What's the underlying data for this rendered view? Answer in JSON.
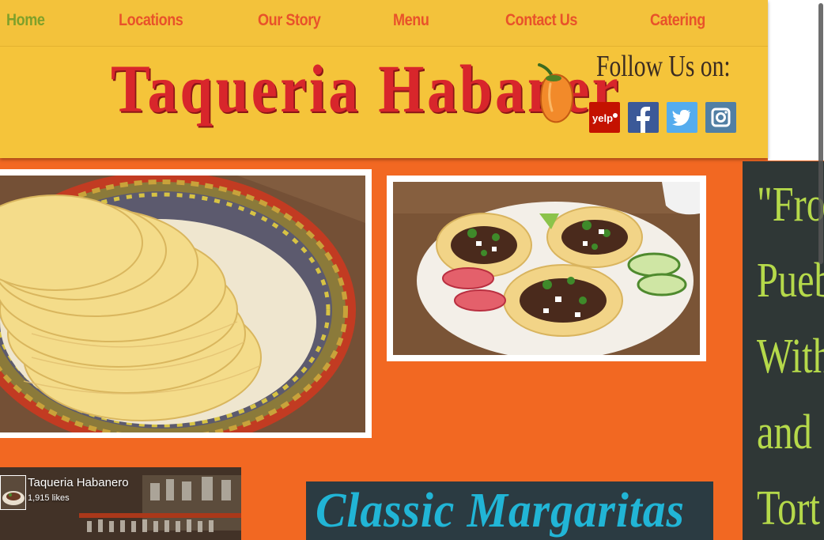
{
  "nav": {
    "items": [
      {
        "label": "Home"
      },
      {
        "label": "Locations"
      },
      {
        "label": "Our Story"
      },
      {
        "label": "Menu"
      },
      {
        "label": "Contact Us"
      },
      {
        "label": "Catering"
      }
    ],
    "active": "Home"
  },
  "brand": {
    "title": "Taqueria Habaner"
  },
  "social": {
    "heading": "Follow Us on:",
    "links": [
      {
        "name": "yelp",
        "label": "yelp",
        "color": "#c41200"
      },
      {
        "name": "facebook",
        "label": "f",
        "color": "#3b5998"
      },
      {
        "name": "twitter",
        "label": "twitter",
        "color": "#55acee"
      },
      {
        "name": "instagram",
        "label": "instagram",
        "color": "#517fa4"
      }
    ]
  },
  "facebook_widget": {
    "page_name": "Taqueria Habanero",
    "likes": "1,915 likes"
  },
  "chalkboard": {
    "lines": [
      "\"Fro",
      "Pueb",
      "With",
      "and",
      "Tort"
    ]
  },
  "margaritas": {
    "text": "Classic Margaritas"
  },
  "colors": {
    "page_bg": "#f26822",
    "header_bg": "#f5c43a",
    "nav_link": "#e8522a",
    "nav_active": "#7fa02a",
    "title_red": "#d8262b",
    "chalk_green": "#b5d94a",
    "margarita_blue": "#21b5d6"
  }
}
